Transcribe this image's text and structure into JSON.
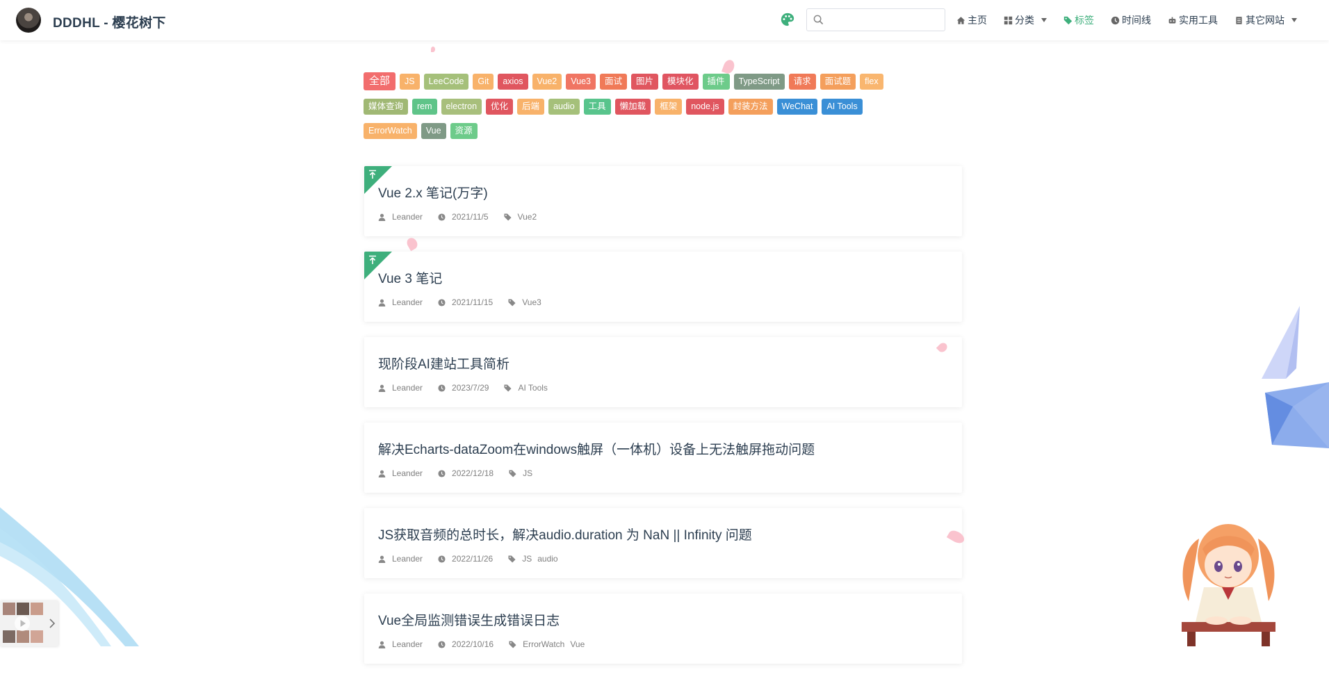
{
  "site": {
    "title": "DDDHL - 樱花树下"
  },
  "search": {
    "placeholder": "",
    "value": ""
  },
  "nav": {
    "items": [
      {
        "label": "主页",
        "icon": "home-icon",
        "active": false
      },
      {
        "label": "分类",
        "icon": "grid-icon",
        "active": false,
        "dropdown": true
      },
      {
        "label": "标签",
        "icon": "tag-icon",
        "active": true
      },
      {
        "label": "时间线",
        "icon": "clock-icon",
        "active": false
      },
      {
        "label": "实用工具",
        "icon": "robot-icon",
        "active": false
      },
      {
        "label": "其它网站",
        "icon": "document-icon",
        "active": false,
        "dropdown": true
      }
    ]
  },
  "tags": [
    {
      "label": "全部",
      "color": "#f26d6d",
      "first": true
    },
    {
      "label": "JS",
      "color": "#f8b26a"
    },
    {
      "label": "LeeCode",
      "color": "#a5c07a"
    },
    {
      "label": "Git",
      "color": "#f8b26a"
    },
    {
      "label": "axios",
      "color": "#e0565f"
    },
    {
      "label": "Vue2",
      "color": "#f8b26a"
    },
    {
      "label": "Vue3",
      "color": "#f07563"
    },
    {
      "label": "面试",
      "color": "#f07a58"
    },
    {
      "label": "图片",
      "color": "#e0565f"
    },
    {
      "label": "模块化",
      "color": "#e05561"
    },
    {
      "label": "插件",
      "color": "#6dcb8a"
    },
    {
      "label": "TypeScript",
      "color": "#7f9a86"
    },
    {
      "label": "请求",
      "color": "#f07a58"
    },
    {
      "label": "面试题",
      "color": "#f49f5c"
    },
    {
      "label": "flex",
      "color": "#f9b66f"
    },
    {
      "label": "媒体查询",
      "color": "#a0b874"
    },
    {
      "label": "rem",
      "color": "#5fc489"
    },
    {
      "label": "electron",
      "color": "#a8bf7c"
    },
    {
      "label": "优化",
      "color": "#e0565f"
    },
    {
      "label": "后端",
      "color": "#f8b26a"
    },
    {
      "label": "audio",
      "color": "#a5c07a"
    },
    {
      "label": "工具",
      "color": "#58c48c"
    },
    {
      "label": "懒加载",
      "color": "#e0565f"
    },
    {
      "label": "框架",
      "color": "#f8b26a"
    },
    {
      "label": "node.js",
      "color": "#e0565f"
    },
    {
      "label": "封装方法",
      "color": "#f49f5c"
    },
    {
      "label": "WeChat",
      "color": "#3a8fd6"
    },
    {
      "label": "AI Tools",
      "color": "#3a8fd6"
    },
    {
      "label": "ErrorWatch",
      "color": "#f8b26a"
    },
    {
      "label": "Vue",
      "color": "#7f9a86"
    },
    {
      "label": "资源",
      "color": "#6dcb8a"
    }
  ],
  "posts": [
    {
      "title": "Vue 2.x 笔记(万字)",
      "author": "Leander",
      "date": "2021/11/5",
      "tags": [
        "Vue2"
      ],
      "pinned": true
    },
    {
      "title": "Vue 3 笔记",
      "author": "Leander",
      "date": "2021/11/15",
      "tags": [
        "Vue3"
      ],
      "pinned": true
    },
    {
      "title": "现阶段AI建站工具简析",
      "author": "Leander",
      "date": "2023/7/29",
      "tags": [
        "AI Tools"
      ],
      "pinned": false
    },
    {
      "title": "解决Echarts-dataZoom在windows触屏（一体机）设备上无法触屏拖动问题",
      "author": "Leander",
      "date": "2022/12/18",
      "tags": [
        "JS"
      ],
      "pinned": false
    },
    {
      "title": "JS获取音频的总时长，解决audio.duration 为 NaN || Infinity 问题",
      "author": "Leander",
      "date": "2022/11/26",
      "tags": [
        "JS",
        "audio"
      ],
      "pinned": false
    },
    {
      "title": "Vue全局监测错误生成错误日志",
      "author": "Leander",
      "date": "2022/10/16",
      "tags": [
        "ErrorWatch",
        "Vue"
      ],
      "pinned": false
    }
  ],
  "colors": {
    "accent": "#3eaf7c",
    "text": "#2c3e50",
    "meta": "#7f7f7f"
  }
}
